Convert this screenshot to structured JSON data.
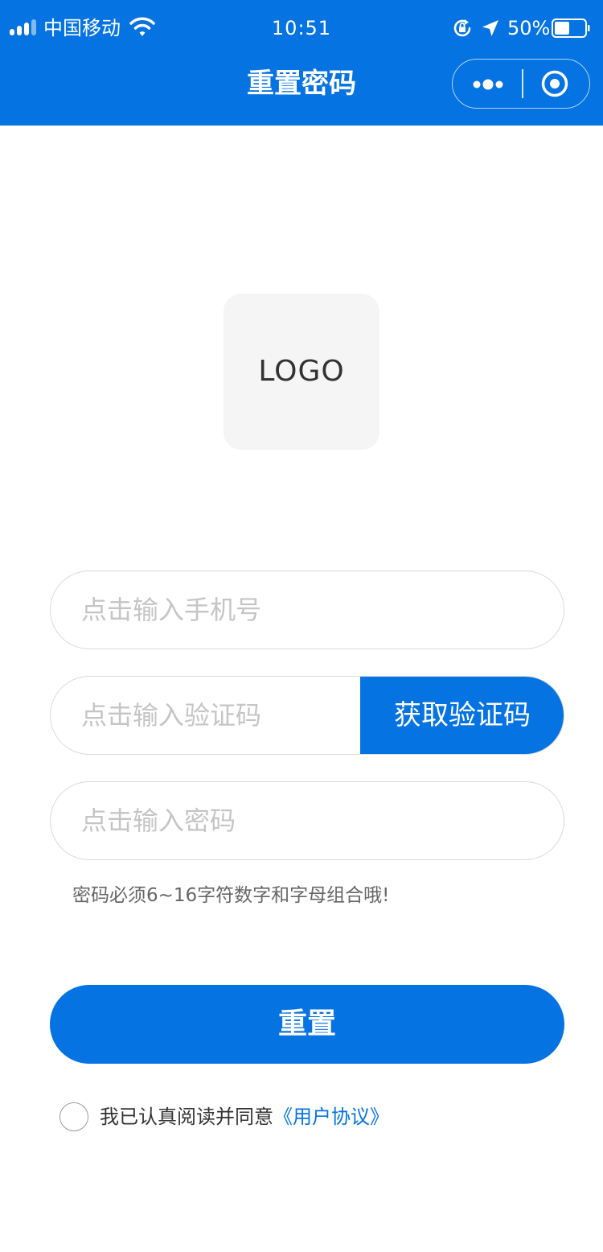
{
  "status_bar": {
    "carrier": "中国移动",
    "time": "10:51",
    "battery_percent": "50%",
    "battery_level": 0.5,
    "icons": [
      "signal-icon",
      "wifi-icon",
      "rotation-lock-icon",
      "location-arrow-icon",
      "battery-icon"
    ]
  },
  "nav": {
    "title": "重置密码",
    "capsule_icons": [
      "more-dots-icon",
      "close-circle-icon"
    ]
  },
  "logo": {
    "text": "LOGO"
  },
  "form": {
    "phone_placeholder": "点击输入手机号",
    "code_placeholder": "点击输入验证码",
    "get_code_label": "获取验证码",
    "password_placeholder": "点击输入密码",
    "password_hint": "密码必须6~16字符数字和字母组合哦!",
    "submit_label": "重置"
  },
  "agreement": {
    "text": "我已认真阅读并同意",
    "link_text": "《用户协议》",
    "checked": false
  },
  "colors": {
    "primary": "#0573E1",
    "input_border": "#DADADA",
    "placeholder": "#C5C5C5",
    "logo_bg": "#F5F5F5"
  }
}
